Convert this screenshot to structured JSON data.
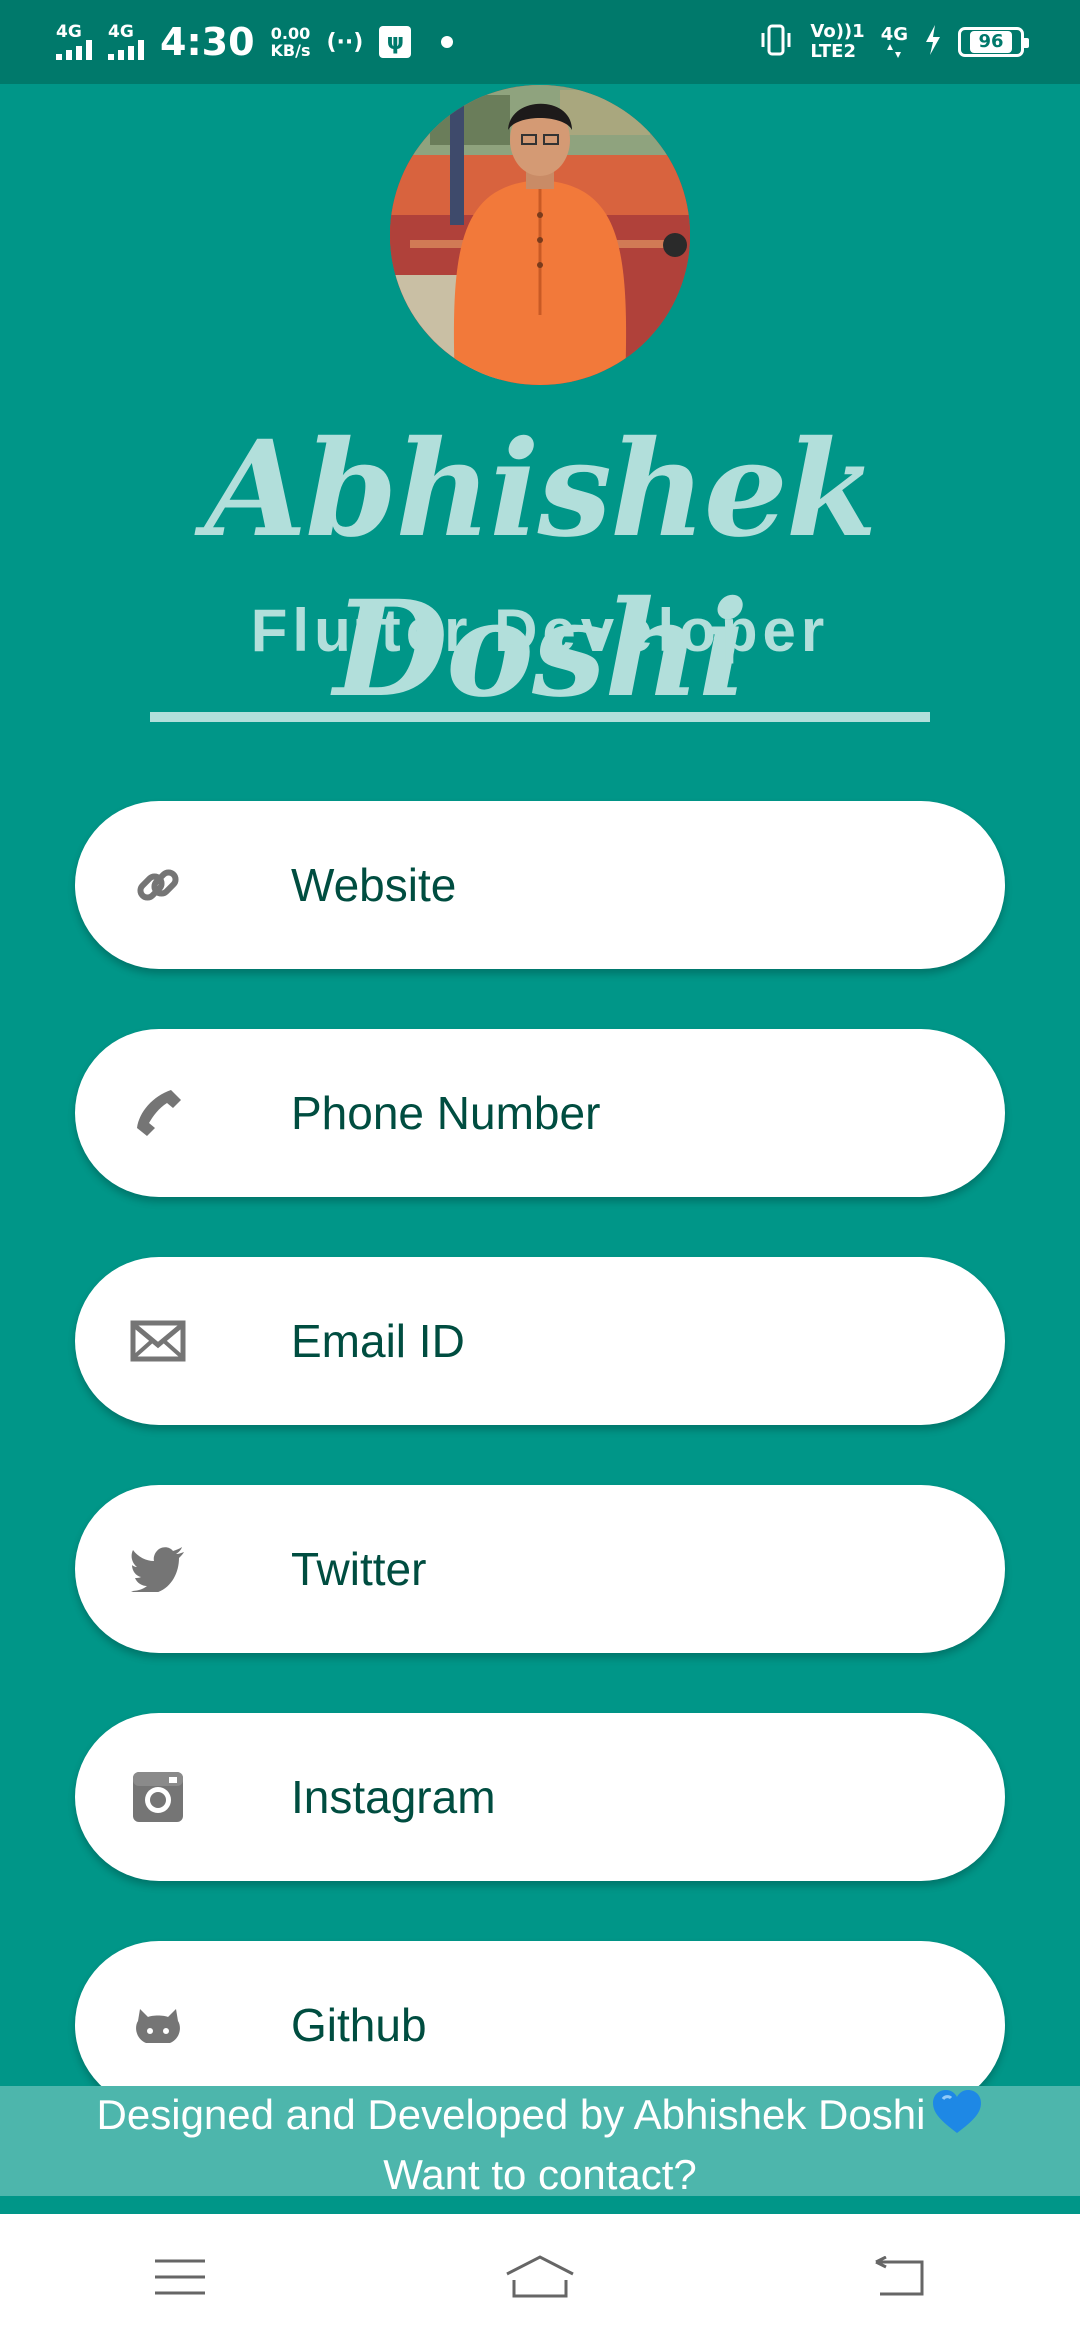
{
  "status_bar": {
    "sim1_network": "4G",
    "sim2_network": "4G",
    "time": "4:30",
    "speed_value": "0.00",
    "speed_unit": "KB/s",
    "hotspot_symbol": "(··)",
    "usb_symbol": "ψ",
    "volte_top": "Vo))1",
    "volte_bottom": "LTE2",
    "lte_network": "4G",
    "battery": "96",
    "icons": [
      "signal-icon",
      "hotspot-icon",
      "usb-icon",
      "vibrate-icon",
      "volte-icon",
      "charging-icon",
      "battery-icon"
    ]
  },
  "profile": {
    "name": "Abhishek Doshi",
    "title": "Flutter Developer"
  },
  "contacts": [
    {
      "label": "Website",
      "icon": "link-icon"
    },
    {
      "label": "Phone Number",
      "icon": "phone-icon"
    },
    {
      "label": "Email ID",
      "icon": "email-icon"
    },
    {
      "label": "Twitter",
      "icon": "twitter-icon"
    },
    {
      "label": "Instagram",
      "icon": "instagram-icon"
    },
    {
      "label": "Github",
      "icon": "github-icon"
    }
  ],
  "footer": {
    "line1": "Designed and Developed by Abhishek Doshi",
    "line2": "Want to contact?"
  },
  "navigation": [
    "menu-icon",
    "home-icon",
    "back-icon"
  ],
  "colors": {
    "background": "#009688",
    "status_bar": "#00796b",
    "accent_text": "#b2dfdb",
    "card": "#ffffff",
    "card_text": "#004d40",
    "footer_band": "#4db6ac",
    "heart": "#1e88e5",
    "icon_gray": "#757575"
  }
}
